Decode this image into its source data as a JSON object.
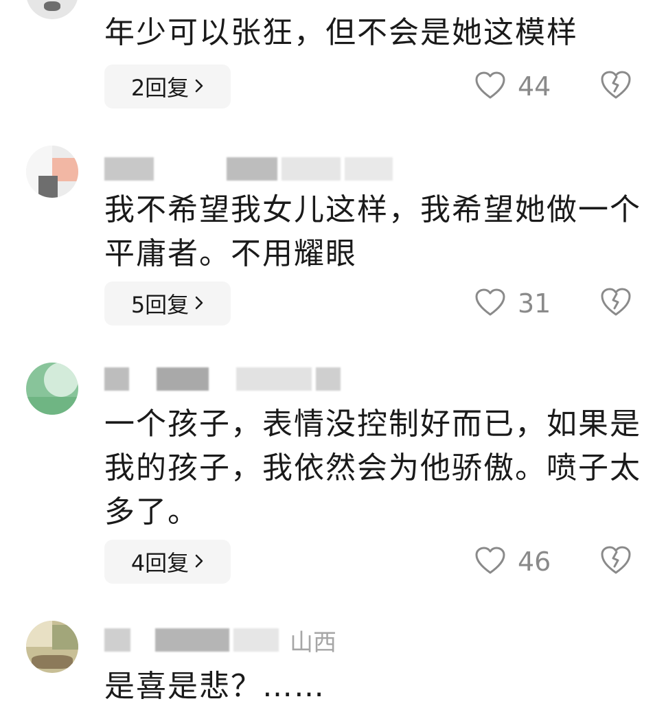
{
  "comments": [
    {
      "text": "年少可以张狂，但不会是她这模样",
      "reply_label": "2回复",
      "likes": "44",
      "region": "",
      "avatar_colors": [
        "#e8e8e8",
        "#cfcfcf"
      ]
    },
    {
      "text": "我不希望我女儿这样，我希望她做一个平庸者。不用耀眼",
      "reply_label": "5回复",
      "likes": "31",
      "region": "",
      "avatar_colors": [
        "#f1e4de",
        "#e9b8a8"
      ]
    },
    {
      "text": "一个孩子，表情没控制好而已，如果是我的孩子，我依然会为他骄傲。喷子太多了。",
      "reply_label": "4回复",
      "likes": "46",
      "region": "",
      "avatar_colors": [
        "#7fbf92",
        "#c6e6cf"
      ]
    },
    {
      "text": "是喜是悲？……",
      "reply_label": "",
      "likes": "",
      "region": "山西",
      "avatar_colors": [
        "#b9ae88",
        "#dcd6bf"
      ]
    }
  ],
  "icons": {
    "like": "heart-outline-icon",
    "dislike": "broken-heart-icon",
    "chevron": "chevron-right-icon"
  },
  "colors": {
    "reply_bg": "#f5f5f5",
    "meta_text": "#8a8a8a",
    "region_text": "#a6a6a6"
  }
}
